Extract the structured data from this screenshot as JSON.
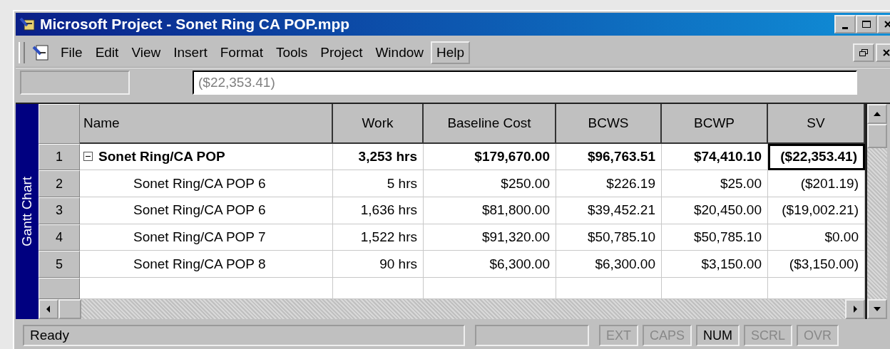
{
  "window": {
    "title": "Microsoft Project - Sonet Ring CA POP.mpp"
  },
  "menu": [
    {
      "label": "File",
      "selected": false
    },
    {
      "label": "Edit",
      "selected": false
    },
    {
      "label": "View",
      "selected": false
    },
    {
      "label": "Insert",
      "selected": false
    },
    {
      "label": "Format",
      "selected": false
    },
    {
      "label": "Tools",
      "selected": false
    },
    {
      "label": "Project",
      "selected": false
    },
    {
      "label": "Window",
      "selected": false
    },
    {
      "label": "Help",
      "selected": true
    }
  ],
  "entry_bar": {
    "value": "($22,353.41)"
  },
  "view_bar": {
    "label": "Gantt Chart"
  },
  "table": {
    "columns": [
      "Name",
      "Work",
      "Baseline Cost",
      "BCWS",
      "BCWP",
      "SV"
    ],
    "rows": [
      {
        "id": "1",
        "expanded": true,
        "cells": [
          {
            "text": "Sonet Ring/CA POP",
            "selected": false
          },
          {
            "text": "3,253 hrs",
            "selected": false
          },
          {
            "text": "$179,670.00",
            "selected": false
          },
          {
            "text": "$96,763.51",
            "selected": false
          },
          {
            "text": "$74,410.10",
            "selected": false
          },
          {
            "text": "($22,353.41)",
            "selected": true
          }
        ],
        "children": [
          {
            "id": "2",
            "cells": [
              {
                "text": "Sonet Ring/CA POP 6",
                "selected": false
              },
              {
                "text": "5 hrs",
                "selected": false
              },
              {
                "text": "$250.00",
                "selected": false
              },
              {
                "text": "$226.19",
                "selected": false
              },
              {
                "text": "$25.00",
                "selected": false
              },
              {
                "text": "($201.19)",
                "selected": false
              }
            ]
          },
          {
            "id": "3",
            "cells": [
              {
                "text": "Sonet Ring/CA POP 6",
                "selected": false
              },
              {
                "text": "1,636 hrs",
                "selected": false
              },
              {
                "text": "$81,800.00",
                "selected": false
              },
              {
                "text": "$39,452.21",
                "selected": false
              },
              {
                "text": "$20,450.00",
                "selected": false
              },
              {
                "text": "($19,002.21)",
                "selected": false
              }
            ]
          },
          {
            "id": "4",
            "cells": [
              {
                "text": "Sonet Ring/CA POP 7",
                "selected": false
              },
              {
                "text": "1,522 hrs",
                "selected": false
              },
              {
                "text": "$91,320.00",
                "selected": false
              },
              {
                "text": "$50,785.10",
                "selected": false
              },
              {
                "text": "$50,785.10",
                "selected": false
              },
              {
                "text": "$0.00",
                "selected": false
              }
            ]
          },
          {
            "id": "5",
            "cells": [
              {
                "text": "Sonet Ring/CA POP 8",
                "selected": false
              },
              {
                "text": "90 hrs",
                "selected": false
              },
              {
                "text": "$6,300.00",
                "selected": false
              },
              {
                "text": "$6,300.00",
                "selected": false
              },
              {
                "text": "$3,150.00",
                "selected": false
              },
              {
                "text": "($3,150.00)",
                "selected": false
              }
            ]
          }
        ]
      }
    ]
  },
  "status_bar": {
    "text": "Ready",
    "indicators": [
      {
        "label": "EXT",
        "on": false
      },
      {
        "label": "CAPS",
        "on": false
      },
      {
        "label": "NUM",
        "on": true
      },
      {
        "label": "SCRL",
        "on": false
      },
      {
        "label": "OVR",
        "on": false
      }
    ]
  }
}
